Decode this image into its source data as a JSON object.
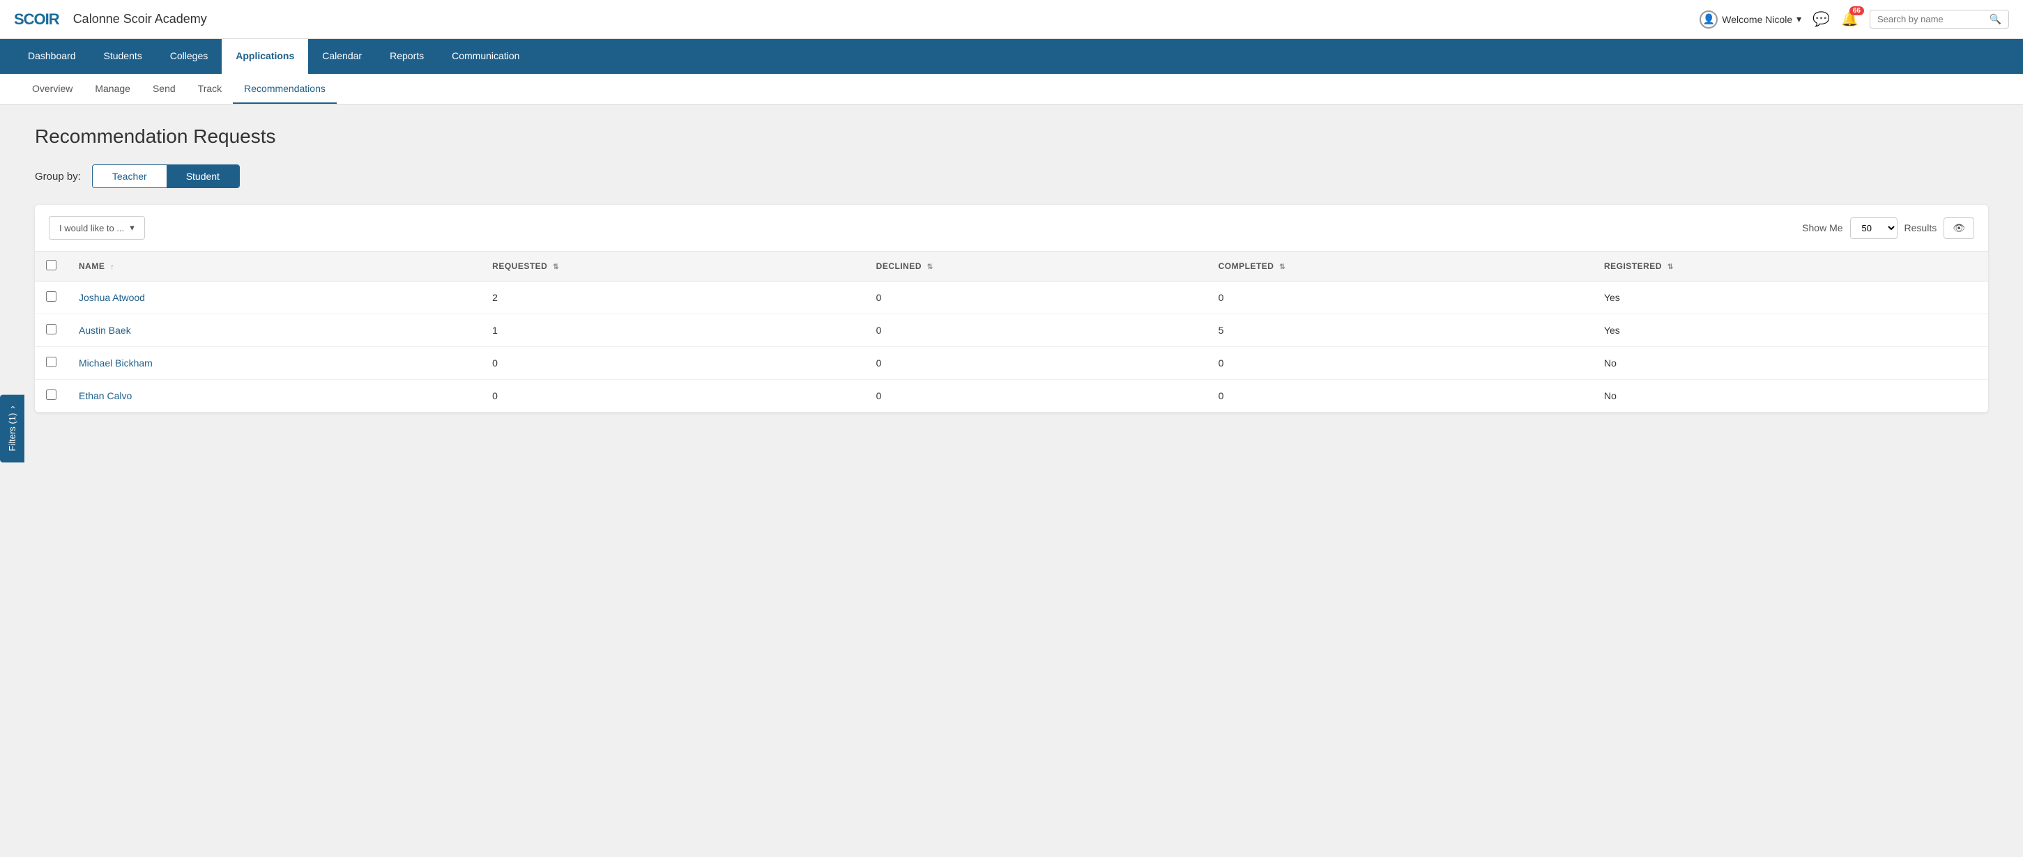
{
  "app": {
    "logo": "SCOIR",
    "academy_name": "Calonne Scoir Academy"
  },
  "top_right": {
    "welcome": "Welcome Nicole",
    "chevron": "▾",
    "notification_count": "66"
  },
  "nav": {
    "items": [
      {
        "label": "Dashboard",
        "active": false
      },
      {
        "label": "Students",
        "active": false
      },
      {
        "label": "Colleges",
        "active": false
      },
      {
        "label": "Applications",
        "active": true
      },
      {
        "label": "Calendar",
        "active": false
      },
      {
        "label": "Reports",
        "active": false
      },
      {
        "label": "Communication",
        "active": false
      }
    ],
    "search_placeholder": "Search by name"
  },
  "sub_nav": {
    "items": [
      {
        "label": "Overview",
        "active": false
      },
      {
        "label": "Manage",
        "active": false
      },
      {
        "label": "Send",
        "active": false
      },
      {
        "label": "Track",
        "active": false
      },
      {
        "label": "Recommendations",
        "active": true
      }
    ]
  },
  "page": {
    "title": "Recommendation Requests",
    "group_by_label": "Group by:",
    "group_by_buttons": [
      {
        "label": "Teacher",
        "active": false
      },
      {
        "label": "Student",
        "active": true
      }
    ],
    "filters_tab": "Filters (1)"
  },
  "toolbar": {
    "action_dropdown": "I would like to ...",
    "show_me_label": "Show Me",
    "show_me_value": "50",
    "results_label": "Results"
  },
  "table": {
    "columns": [
      {
        "key": "name",
        "label": "NAME",
        "sortable": true,
        "sort_dir": "asc"
      },
      {
        "key": "requested",
        "label": "REQUESTED",
        "sortable": true
      },
      {
        "key": "declined",
        "label": "DECLINED",
        "sortable": true
      },
      {
        "key": "completed",
        "label": "COMPLETED",
        "sortable": true
      },
      {
        "key": "registered",
        "label": "REGISTERED",
        "sortable": true
      }
    ],
    "rows": [
      {
        "name": "Joshua Atwood",
        "requested": 2,
        "declined": 0,
        "completed": 0,
        "registered": "Yes"
      },
      {
        "name": "Austin Baek",
        "requested": 1,
        "declined": 0,
        "completed": 5,
        "registered": "Yes"
      },
      {
        "name": "Michael Bickham",
        "requested": 0,
        "declined": 0,
        "completed": 0,
        "registered": "No"
      },
      {
        "name": "Ethan Calvo",
        "requested": 0,
        "declined": 0,
        "completed": 0,
        "registered": "No"
      }
    ]
  }
}
